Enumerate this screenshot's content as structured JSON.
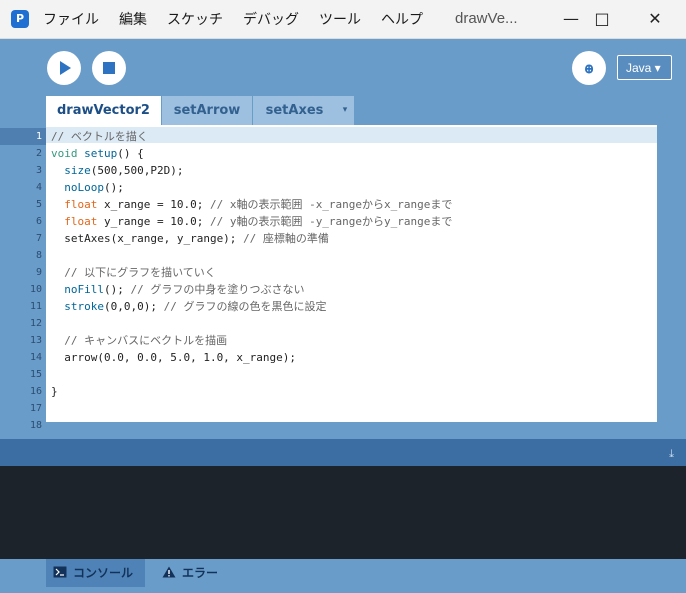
{
  "app": {
    "logo": "processing-logo-icon",
    "title": "drawVe..."
  },
  "menu": [
    "ファイル",
    "編集",
    "スケッチ",
    "デバッグ",
    "ツール",
    "ヘルプ"
  ],
  "window_controls": {
    "minimize": "—",
    "maximize": "□",
    "close": "✕"
  },
  "toolbar": {
    "debug_symbol": "ꚛ",
    "mode": "Java ▾"
  },
  "tabs": [
    "drawVector2",
    "setArrow",
    "setAxes"
  ],
  "tab_menu_symbol": "▾",
  "editor": {
    "line_numbers": [
      "1",
      "2",
      "3",
      "4",
      "5",
      "6",
      "7",
      "8",
      "9",
      "10",
      "11",
      "12",
      "13",
      "14",
      "15",
      "16",
      "17",
      "18"
    ],
    "lines": [
      [
        {
          "t": "// ベクトルを描く",
          "c": "#666666"
        }
      ],
      [
        {
          "t": "void ",
          "c": "#33997e"
        },
        {
          "t": "setup",
          "c": "#006699"
        },
        {
          "t": "() {",
          "c": "#222222"
        }
      ],
      [
        {
          "t": "  size",
          "c": "#006699"
        },
        {
          "t": "(500,500,P2D);",
          "c": "#222222"
        }
      ],
      [
        {
          "t": "  noLoop",
          "c": "#006699"
        },
        {
          "t": "();",
          "c": "#222222"
        }
      ],
      [
        {
          "t": "  float ",
          "c": "#e2661a"
        },
        {
          "t": "x_range = 10.0; ",
          "c": "#222222"
        },
        {
          "t": "// x軸の表示範囲 -x_rangeからx_rangeまで",
          "c": "#666666"
        }
      ],
      [
        {
          "t": "  float ",
          "c": "#e2661a"
        },
        {
          "t": "y_range = 10.0; ",
          "c": "#222222"
        },
        {
          "t": "// y軸の表示範囲 -y_rangeからy_rangeまで",
          "c": "#666666"
        }
      ],
      [
        {
          "t": "  setAxes(x_range, y_range); ",
          "c": "#222222"
        },
        {
          "t": "// 座標軸の準備",
          "c": "#666666"
        }
      ],
      [
        {
          "t": "",
          "c": "#222222"
        }
      ],
      [
        {
          "t": "  // 以下にグラフを描いていく",
          "c": "#666666"
        }
      ],
      [
        {
          "t": "  noFill",
          "c": "#006699"
        },
        {
          "t": "(); ",
          "c": "#222222"
        },
        {
          "t": "// グラフの中身を塗りつぶさない",
          "c": "#666666"
        }
      ],
      [
        {
          "t": "  stroke",
          "c": "#006699"
        },
        {
          "t": "(0,0,0); ",
          "c": "#222222"
        },
        {
          "t": "// グラフの線の色を黒色に設定",
          "c": "#666666"
        }
      ],
      [
        {
          "t": "",
          "c": "#222222"
        }
      ],
      [
        {
          "t": "  // キャンバスにベクトルを描画",
          "c": "#666666"
        }
      ],
      [
        {
          "t": "  arrow(0.0, 0.0, 5.0, 1.0, x_range);",
          "c": "#222222"
        }
      ],
      [
        {
          "t": "",
          "c": "#222222"
        }
      ],
      [
        {
          "t": "}",
          "c": "#222222"
        }
      ]
    ]
  },
  "bottom_tabs": [
    {
      "label": "コンソール",
      "icon": "console-icon"
    },
    {
      "label": "エラー",
      "icon": "warning-icon"
    }
  ],
  "split_icon": "collapse-icon"
}
